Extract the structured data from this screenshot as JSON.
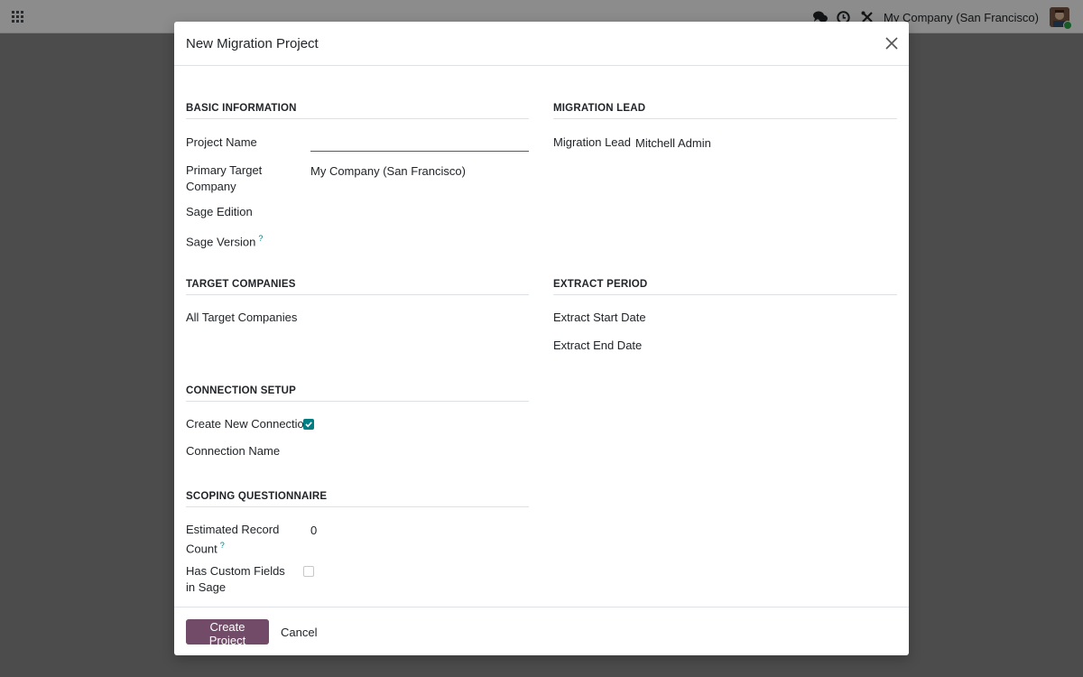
{
  "navbar": {
    "company": "My Company (San Francisco)"
  },
  "dialog": {
    "title": "New Migration Project",
    "sections": {
      "basic_information": {
        "title": "BASIC INFORMATION",
        "project_name_label": "Project Name",
        "project_name_value": "",
        "primary_target_company_label": "Primary Target Company",
        "primary_target_company_value": "My Company (San Francisco)",
        "sage_edition_label": "Sage Edition",
        "sage_version_label": "Sage Version",
        "help_mark": "?"
      },
      "migration_lead": {
        "title": "MIGRATION LEAD",
        "migration_lead_label": "Migration Lead",
        "migration_lead_value": "Mitchell Admin"
      },
      "target_companies": {
        "title": "TARGET COMPANIES",
        "all_target_companies_label": "All Target Companies"
      },
      "extract_period": {
        "title": "EXTRACT PERIOD",
        "extract_start_date_label": "Extract Start Date",
        "extract_end_date_label": "Extract End Date"
      },
      "connection_setup": {
        "title": "CONNECTION SETUP",
        "create_new_connection_label": "Create New Connection",
        "create_new_connection_checked": true,
        "connection_name_label": "Connection Name"
      },
      "scoping_questionnaire": {
        "title": "SCOPING QUESTIONNAIRE",
        "estimated_record_count_label": "Estimated Record Count",
        "estimated_record_count_value": "0",
        "has_custom_fields_label": "Has Custom Fields in Sage",
        "has_custom_fields_checked": false,
        "help_mark": "?"
      }
    },
    "footer": {
      "create_label": "Create Project",
      "cancel_label": "Cancel"
    }
  },
  "colors": {
    "primary": "#714b67",
    "accent": "#017e84"
  }
}
